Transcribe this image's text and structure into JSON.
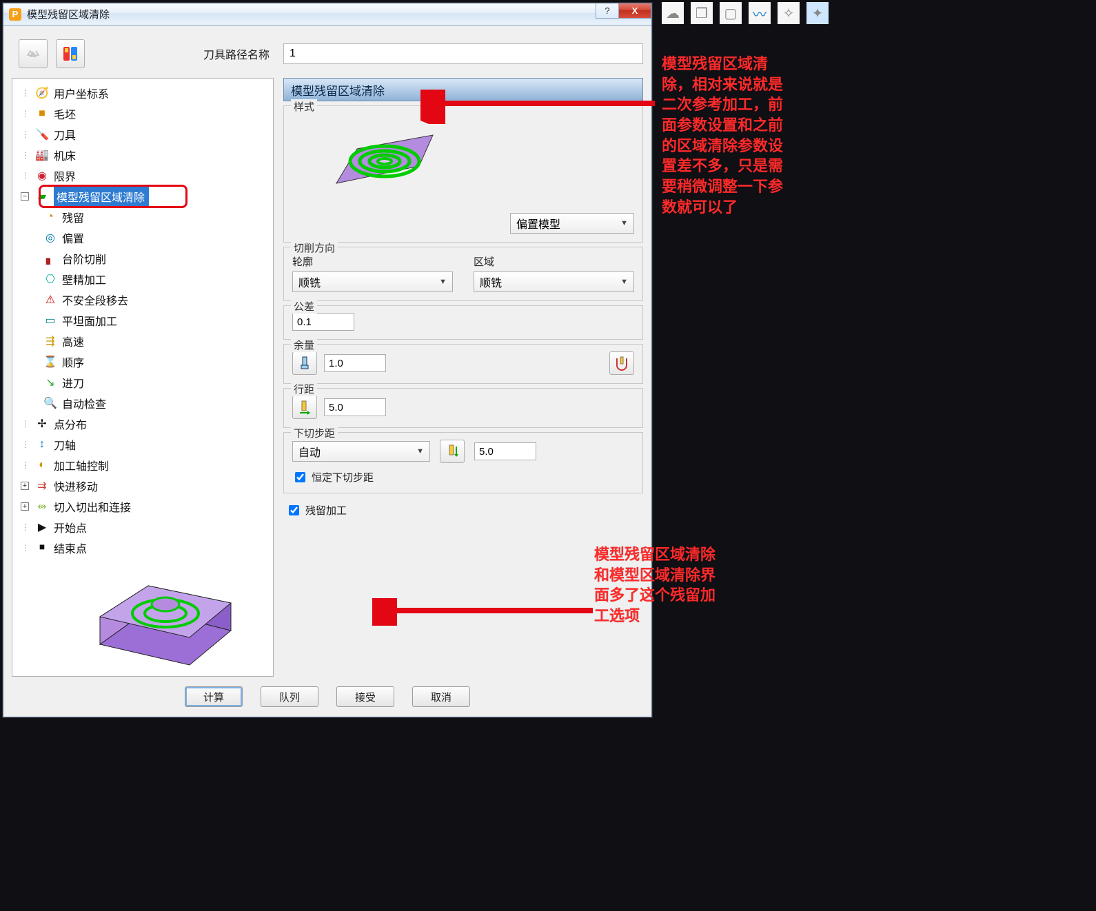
{
  "window": {
    "title": "模型残留区域清除",
    "help": "?",
    "close": "X"
  },
  "toolpath_name": {
    "label": "刀具路径名称",
    "value": "1"
  },
  "tree": {
    "items": [
      {
        "label": "用户坐标系"
      },
      {
        "label": "毛坯"
      },
      {
        "label": "刀具"
      },
      {
        "label": "机床"
      },
      {
        "label": "限界"
      },
      {
        "label": "模型残留区域清除",
        "selected": true
      },
      {
        "label": "残留",
        "child": true
      },
      {
        "label": "偏置",
        "child": true
      },
      {
        "label": "台阶切削",
        "child": true
      },
      {
        "label": "壁精加工",
        "child": true
      },
      {
        "label": "不安全段移去",
        "child": true
      },
      {
        "label": "平坦面加工",
        "child": true
      },
      {
        "label": "高速",
        "child": true
      },
      {
        "label": "顺序",
        "child": true
      },
      {
        "label": "进刀",
        "child": true
      },
      {
        "label": "自动检查",
        "child": true
      },
      {
        "label": "点分布"
      },
      {
        "label": "刀轴"
      },
      {
        "label": "加工轴控制"
      },
      {
        "label": "快进移动",
        "expand": true
      },
      {
        "label": "切入切出和连接",
        "expand": true
      },
      {
        "label": "开始点"
      },
      {
        "label": "结束点"
      }
    ]
  },
  "panel": {
    "title": "模型残留区域清除",
    "style": {
      "legend": "样式",
      "select": "偏置模型"
    },
    "cutdir": {
      "legend": "切削方向",
      "profile_label": "轮廓",
      "profile_value": "顺铣",
      "area_label": "区域",
      "area_value": "顺铣"
    },
    "tolerance": {
      "legend": "公差",
      "value": "0.1"
    },
    "stock": {
      "legend": "余量",
      "value": "1.0"
    },
    "stepover": {
      "legend": "行距",
      "value": "5.0"
    },
    "stepdown": {
      "legend": "下切步距",
      "mode": "自动",
      "value": "5.0",
      "constant_label": "恒定下切步距",
      "constant_checked": true
    },
    "rest": {
      "label": "残留加工",
      "checked": true
    }
  },
  "buttons": {
    "calc": "计算",
    "queue": "队列",
    "accept": "接受",
    "cancel": "取消"
  },
  "annotations": {
    "top": "模型残留区域清\n除，相对来说就是\n二次参考加工，前\n面参数设置和之前\n的区域清除参数设\n置差不多，只是需\n要稍微调整一下参\n数就可以了",
    "bottom": "模型残留区域清除\n和模型区域清除界\n面多了这个残留加\n工选项"
  }
}
